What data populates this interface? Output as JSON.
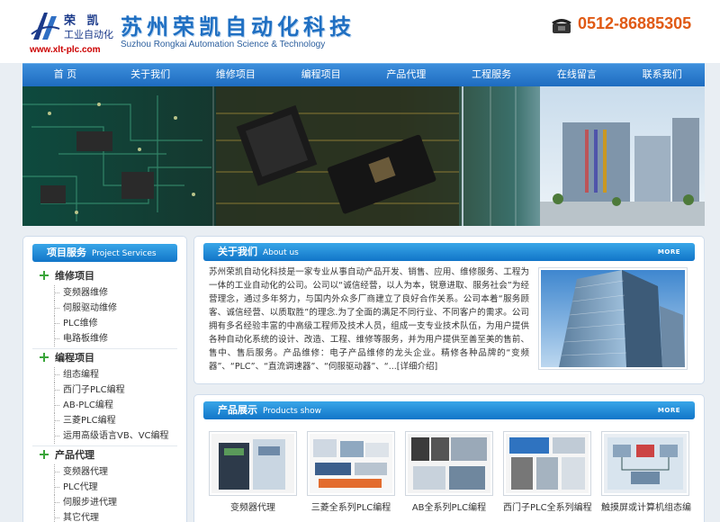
{
  "header": {
    "logo_cn": "荣 凯",
    "logo_sub": "工业自动化",
    "logo_url": "www.xlt-plc.com",
    "company_cn": "苏州荣凯自动化科技",
    "company_en": "Suzhou Rongkai Automation Science & Technology",
    "phone": "0512-86885305"
  },
  "nav": {
    "items": [
      "首 页",
      "关于我们",
      "维修项目",
      "编程项目",
      "产品代理",
      "工程服务",
      "在线留言",
      "联系我们"
    ]
  },
  "services": {
    "title": "项目服务",
    "title_en": "Project Services",
    "categories": [
      {
        "name": "维修项目",
        "items": [
          "变频器维修",
          "伺服驱动维修",
          "PLC维修",
          "电路板维修"
        ]
      },
      {
        "name": "编程项目",
        "items": [
          "组态编程",
          "西门子PLC编程",
          "AB-PLC编程",
          "三菱PLC编程",
          "运用高级语言VB、VC编程"
        ]
      },
      {
        "name": "产品代理",
        "items": [
          "变频器代理",
          "PLC代理",
          "伺服步进代理",
          "其它代理"
        ]
      }
    ]
  },
  "about": {
    "title": "关于我们",
    "title_en": "About us",
    "more": "MORE",
    "text": "苏州荣凯自动化科技是一家专业从事自动产品开发、销售、应用、维修服务、工程为一体的工业自动化的公司。公司以“诚信经营，以人为本，锐意进取、服务社会”为经营理念，通过多年努力，与国内外众多厂商建立了良好合作关系。公司本着“服务顾客、诚信经营、以质取胜”的理念.为了全面的满足不同行业、不同客户的需求。公司拥有多名经验丰富的中高级工程师及技术人员，组成一支专业技术队伍，为用户提供各种自动化系统的设计、改造、工程、维修等服务，并为用户提供至善至美的售前、售中、售后服务。产品维修：电子产品维修的龙头企业。精修各种品牌的“变频器”、“PLC”、“直流调速器”、“伺服驱动器”、“...",
    "link": "[详细介绍]"
  },
  "products": {
    "title": "产品展示",
    "title_en": "Products show",
    "more": "MORE",
    "items": [
      {
        "caption": "变频器代理"
      },
      {
        "caption": "三菱全系列PLC编程"
      },
      {
        "caption": "AB全系列PLC编程"
      },
      {
        "caption": "西门子PLC全系列编程"
      },
      {
        "caption": "触摸屏或计算机组态编"
      }
    ]
  },
  "colors": {
    "nav_blue": "#1e6cc0",
    "title_blue": "#1f6fc2",
    "phone_orange": "#e05a14",
    "url_red": "#cc0000",
    "plus_green": "#3aa53a"
  }
}
